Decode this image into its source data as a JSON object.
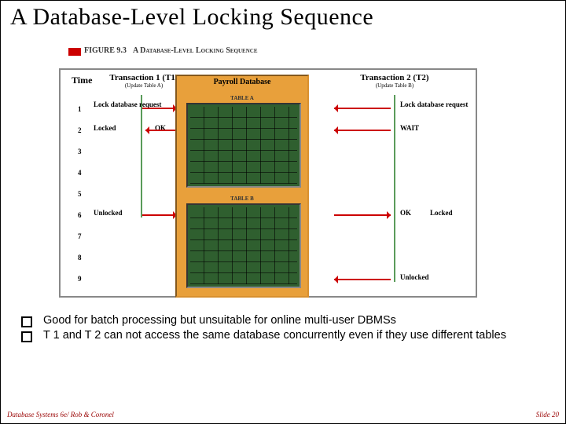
{
  "title": "A Database-Level Locking Sequence",
  "figure": {
    "number": "FIGURE 9.3",
    "caption": "A Database-Level Locking Sequence",
    "time_label": "Time",
    "t1": {
      "title": "Transaction 1 (T1)",
      "sub": "(Update Table A)"
    },
    "t2": {
      "title": "Transaction 2 (T2)",
      "sub": "(Update Table B)"
    },
    "db_title": "Payroll Database",
    "table_a": "TABLE A",
    "table_b": "TABLE B",
    "left_events": {
      "e1": "Lock database request",
      "e2a": "Locked",
      "e2b": "OK",
      "e6": "Unlocked"
    },
    "right_events": {
      "e1": "Lock database request",
      "e2": "WAIT",
      "e6a": "OK",
      "e6b": "Locked",
      "e9": "Unlocked"
    },
    "steps": [
      "1",
      "2",
      "3",
      "4",
      "5",
      "6",
      "7",
      "8",
      "9"
    ]
  },
  "bullets": {
    "b1": "Good for batch processing but unsuitable for online multi-user DBMSs",
    "b2": "T 1 and T 2 can not access the same database concurrently even if they use different tables"
  },
  "footer": {
    "left": "Database Systems 6e/ Rob & Coronel",
    "right": "Slide 20"
  }
}
